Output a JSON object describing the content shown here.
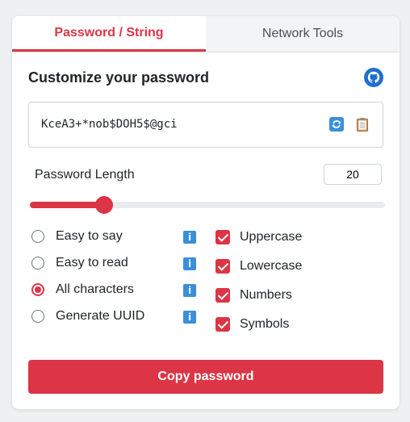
{
  "tabs": [
    {
      "label": "Password / String",
      "active": true
    },
    {
      "label": "Network Tools",
      "active": false
    }
  ],
  "heading": "Customize your password",
  "password": "KceA3+*nob$DOH5$@gci",
  "length": {
    "label": "Password Length",
    "value": "20",
    "fraction": 0.21
  },
  "modes": [
    {
      "label": "Easy to say",
      "selected": false
    },
    {
      "label": "Easy to read",
      "selected": false
    },
    {
      "label": "All characters",
      "selected": true
    },
    {
      "label": "Generate UUID",
      "selected": false
    }
  ],
  "character_sets": [
    {
      "label": "Uppercase",
      "checked": true
    },
    {
      "label": "Lowercase",
      "checked": true
    },
    {
      "label": "Numbers",
      "checked": true
    },
    {
      "label": "Symbols",
      "checked": true
    }
  ],
  "copy_label": "Copy password",
  "colors": {
    "accent": "#dc3545",
    "info": "#3a8fd8"
  },
  "icons": [
    "github-icon",
    "refresh-icon",
    "clipboard-icon",
    "info-icon"
  ]
}
